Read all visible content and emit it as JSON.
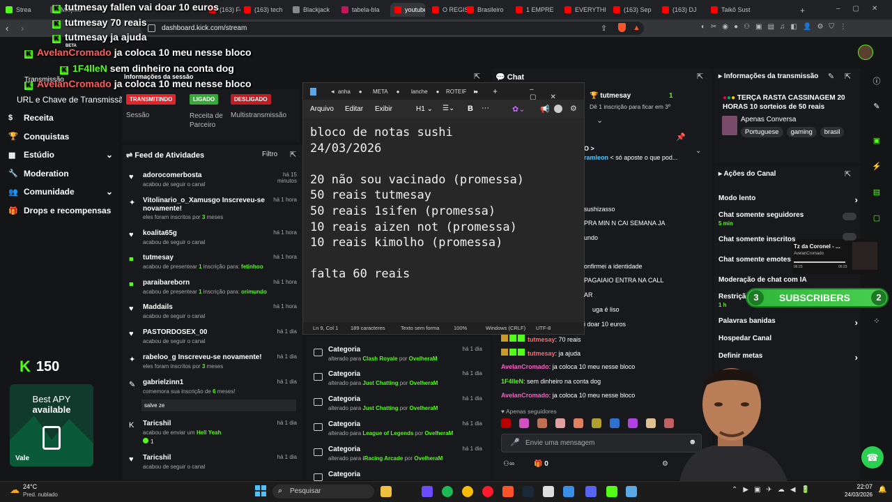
{
  "browser": {
    "tabs": [
      {
        "label": "Strea",
        "color": "#53fc18"
      },
      {
        "label": "Midpad",
        "color": "#555"
      },
      {
        "label": "(163) Fol",
        "color": "#ff0000"
      },
      {
        "label": "(163) tech",
        "color": "#ff0000"
      },
      {
        "label": "Blackjack",
        "color": "#888"
      },
      {
        "label": "tabela-bla",
        "color": "#c2185b"
      },
      {
        "label": "youtube",
        "color": "#ff0000"
      },
      {
        "label": "O REGIST",
        "color": "#ff0000"
      },
      {
        "label": "Brasileiro",
        "color": "#ff0000"
      },
      {
        "label": "1 EMPRE",
        "color": "#ff0000"
      },
      {
        "label": "EVERYTHI",
        "color": "#ff0000"
      },
      {
        "label": "(163) Sep",
        "color": "#ff0000"
      },
      {
        "label": "(163) DJ",
        "color": "#ff0000"
      },
      {
        "label": "Taikō Sust",
        "color": "#ff0000"
      }
    ],
    "new_tab": "+",
    "url": "dashboard.kick.com/stream"
  },
  "overlay_chat": [
    {
      "user": "tutmesay",
      "text": "fallen vai doar 10 euros"
    },
    {
      "user": "tutmesay",
      "text": "70 reais"
    },
    {
      "user": "tutmesay",
      "text": "ja ajuda"
    },
    {
      "user": "AvelanCromado",
      "text": "ja coloca 10 meu nesse bloco"
    },
    {
      "user": "1F4lleN",
      "text": "sem dinheiro na conta dog"
    },
    {
      "user": "AvelanCromado",
      "text": "ja coloca 10 meu nesse bloco"
    }
  ],
  "overlay_small": {
    "beta": "BETA",
    "section": "Informações da sessão",
    "transmissao": "Transmissão"
  },
  "sidebar": {
    "url_key": "URL e Chave de Transmissão",
    "items": [
      {
        "label": "Receita",
        "icon": "dollar-icon"
      },
      {
        "label": "Conquistas",
        "icon": "trophy-icon"
      },
      {
        "label": "Estúdio",
        "icon": "grid-icon",
        "chevron": "⌄"
      },
      {
        "label": "Moderation",
        "icon": "wrench-icon"
      },
      {
        "label": "Comunidade",
        "icon": "people-icon",
        "chevron": "⌄"
      },
      {
        "label": "Drops e recompensas",
        "icon": "gift-icon"
      }
    ],
    "kick_points": "150",
    "promo_line1": "Best APY",
    "promo_line2": "available",
    "promo_logo": "Vale"
  },
  "session": {
    "badges": [
      "TRANSMITINDO",
      "LIGADO",
      "DESLIGADO"
    ],
    "labels": [
      "Sessão",
      "Receita de Parceiro",
      "Multistransmissão"
    ]
  },
  "feed": {
    "title": "Feed de Atividades",
    "filter": "Filtro",
    "items": [
      {
        "name": "adorocomerbosta",
        "sub": "acabou de seguir o canal",
        "time": "há 15 minutos",
        "icon": "heart-icon"
      },
      {
        "name": "Vitolinario_o_Xamusgo Inscreveu-se novamente!",
        "sub": "eles foram inscritos por",
        "hl": "3",
        "sub2": "meses",
        "time": "há 1 hora",
        "icon": "star-icon"
      },
      {
        "name": "koalita65g",
        "sub": "acabou de seguir o canal",
        "time": "há 1 hora",
        "icon": "heart-icon"
      },
      {
        "name": "tutmesay",
        "sub": "acabou de presentear",
        "hl": "1",
        "sub2": "inscrição para:",
        "hl2": "fetinhoo",
        "time": "há 1 hora",
        "icon": "gift-icon"
      },
      {
        "name": "paraibareborn",
        "sub": "acabou de presentear",
        "hl": "1",
        "sub2": "inscrição para:",
        "hl2": "orimundo",
        "time": "há 1 hora",
        "icon": "gift-icon"
      },
      {
        "name": "Maddails",
        "sub": "acabou de seguir o canal",
        "time": "há 1 hora",
        "icon": "heart-icon"
      },
      {
        "name": "PASTORDOSEX_00",
        "sub": "acabou de seguir o canal",
        "time": "há 1 dia",
        "icon": "heart-icon"
      },
      {
        "name": "rabeloo_g Inscreveu-se novamente!",
        "sub": "eles foram inscritos por",
        "hl": "3",
        "sub2": "meses",
        "time": "há 1 dia",
        "icon": "star-icon"
      },
      {
        "name": "gabrielzinn1",
        "sub": "comemora sua inscrição de",
        "hl": "6",
        "sub2": "meses!",
        "note": "salve ze",
        "time": "há 1 dia",
        "icon": "party-icon"
      },
      {
        "name": "Taricshil",
        "sub": "acabou de enviar um",
        "hl2": "Hell Yeah",
        "extra": "1",
        "time": "há 1 dia",
        "icon": "kick-icon"
      },
      {
        "name": "Taricshil",
        "sub": "acabou de seguir o canal",
        "time": "há 1 dia",
        "icon": "heart-icon"
      }
    ]
  },
  "categories": {
    "items": [
      {
        "title": "Categoria",
        "pre": "alterado para",
        "cat": "Clash Royale",
        "by": "por",
        "user": "OvelheraM",
        "time": "há 1 dia"
      },
      {
        "title": "Categoria",
        "pre": "alterado para",
        "cat": "Just Chatting",
        "by": "por",
        "user": "OvelheraM",
        "time": "há 1 dia"
      },
      {
        "title": "Categoria",
        "pre": "alterado para",
        "cat": "Just Chatting",
        "by": "por",
        "user": "OvelheraM",
        "time": "há 1 dia"
      },
      {
        "title": "Categoria",
        "pre": "alterado para",
        "cat": "League of Legends",
        "by": "por",
        "user": "OvelheraM",
        "time": "há 1 dia"
      },
      {
        "title": "Categoria",
        "pre": "alterado para",
        "cat": "iRacing Arcade",
        "by": "por",
        "user": "OvelheraM",
        "time": "há 1 dia"
      },
      {
        "title": "Categoria",
        "time": ""
      }
    ]
  },
  "chat": {
    "title": "Chat",
    "top_user": "tutmesay",
    "top_count": "1",
    "top_sub": "Dê 1 inscrição para ficar em 3º",
    "pinned_prefix": "O >",
    "pinned_user": "ramleon",
    "pinned_text": "< só aposte o que pod...",
    "partial": [
      "sushizasso",
      "PRA MIN N CAI SEMANA JA",
      "undo",
      "onfirmei a identidade",
      "PAGAIAIO ENTRA NA CALL",
      "AR",
      "uga é liso",
      "i doar 10 euros"
    ],
    "messages": [
      {
        "user": "tutmesay",
        "text": ": 70 reais",
        "color": "#ff6b6b"
      },
      {
        "user": "tutmesay",
        "text": ": ja ajuda",
        "color": "#ff6b6b"
      },
      {
        "user": "AvelanCromado",
        "text": ": ja coloca 10 meu nesse bloco",
        "color": "#ff5cc8"
      },
      {
        "user": "1F4lleN",
        "text": ": sem dinheiro na conta dog",
        "color": "#53fc18"
      },
      {
        "user": "AvelanCromado",
        "text": ": ja coloca 10 meu nesse bloco",
        "color": "#ff5cc8"
      }
    ],
    "followers_only": "Apenas seguidores",
    "input_placeholder": "Envie uma mensagem",
    "bottom_count": "0"
  },
  "stream_info": {
    "title": "Informações da transmissão",
    "stream_title": "TERÇA RASTA CASSINAGEM 20 HORAS 10 sorteios de 50 reais",
    "category": "Apenas Conversa",
    "tags": [
      "Portuguese",
      "gaming",
      "brasil"
    ]
  },
  "channel_actions": {
    "title": "Ações do Canal",
    "rows": [
      {
        "label": "Modo lento",
        "chev": "›"
      },
      {
        "label": "Chat somente seguidores",
        "sub": "5 min"
      },
      {
        "label": "Chat somente inscritos"
      },
      {
        "label": "Chat somente emotes"
      },
      {
        "label": "Moderação de chat com IA"
      },
      {
        "label": "Restriçã",
        "sub": "1 h"
      },
      {
        "label": "Palavras banidas",
        "chev": "›"
      },
      {
        "label": "Hospedar Canal"
      },
      {
        "label": "Definir metas",
        "chev": "›"
      }
    ]
  },
  "subs_widget": {
    "left": "3",
    "label": "SUBSCRIBERS",
    "right": "2"
  },
  "music": {
    "title": "Tz da Coronel - ...",
    "artist": "AvelanCromado",
    "t1": "06:23",
    "t2": "06:23"
  },
  "notepad": {
    "tabs": [
      "anha",
      "META",
      "lanche",
      "ROTEIF"
    ],
    "menu": [
      "Arquivo",
      "Editar",
      "Exibir"
    ],
    "heading": "H1",
    "bold": "B",
    "more": "···",
    "lines": [
      "bloco de notas sushi",
      "24/03/2026",
      "",
      "20 não sou vacinado (promessa)",
      "50 reais tutmesay",
      "50 reais 1sifen (promessa)",
      "10 reais aizen not (promessa)",
      "10 reais kimolho (promessa)",
      "",
      "falta 60 reais"
    ],
    "status": [
      "Ln 9, Col 1",
      "189 caracteres",
      "Texto sem forma",
      "100%",
      "Windows (CRLF)",
      "UTF-8"
    ]
  },
  "taskbar": {
    "weather_temp": "24°C",
    "weather_desc": "Pred. nublado",
    "search": "Pesquisar",
    "time": "22:07",
    "date": "24/03/2026"
  }
}
